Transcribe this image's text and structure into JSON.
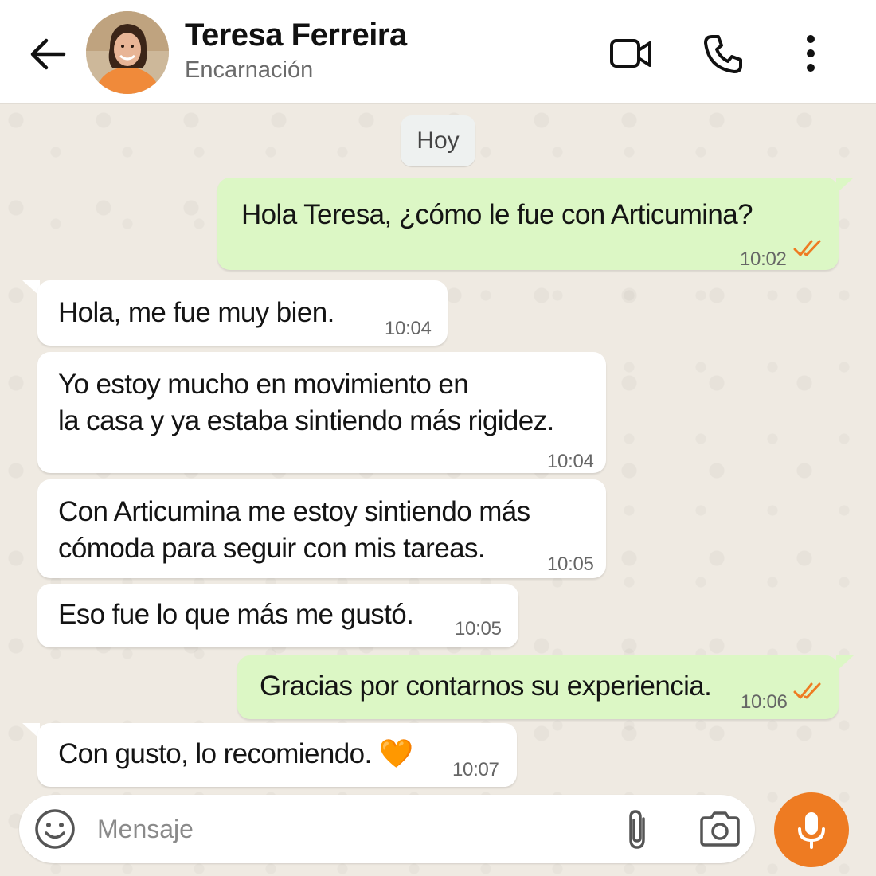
{
  "header": {
    "contact_name": "Teresa Ferreira",
    "contact_subtitle": "Encarnación",
    "icons": [
      "back-arrow-icon",
      "video-call-icon",
      "phone-icon",
      "more-options-icon"
    ]
  },
  "chat": {
    "day_label": "Hoy",
    "messages": [
      {
        "direction": "outgoing",
        "text": "Hola Teresa, ¿cómo le fue con Articumina?",
        "time": "10:02",
        "read": true
      },
      {
        "direction": "incoming",
        "text": "Hola, me fue muy bien.",
        "time": "10:04"
      },
      {
        "direction": "incoming",
        "text": "Yo estoy mucho en movimiento en\nla casa y ya estaba sintiendo más rigidez.",
        "time": "10:04"
      },
      {
        "direction": "incoming",
        "text": "Con Articumina me estoy sintiendo más\ncómoda para seguir con mis tareas.",
        "time": "10:05"
      },
      {
        "direction": "incoming",
        "text": "Eso fue lo que más me gustó.",
        "time": "10:05"
      },
      {
        "direction": "outgoing",
        "text": "Gracias por contarnos su experiencia.",
        "time": "10:06",
        "read": true
      },
      {
        "direction": "incoming",
        "text": "Con gusto, lo recomiendo. 🧡",
        "time": "10:07"
      }
    ]
  },
  "composer": {
    "placeholder": "Mensaje",
    "icons": [
      "emoji-icon",
      "attach-icon",
      "camera-icon",
      "microphone-icon"
    ]
  },
  "colors": {
    "outgoing_bubble": "#dcf7c5",
    "incoming_bubble": "#ffffff",
    "read_ticks": "#ee7b22",
    "mic_button": "#ee7b22",
    "chat_background": "#efeae2"
  }
}
